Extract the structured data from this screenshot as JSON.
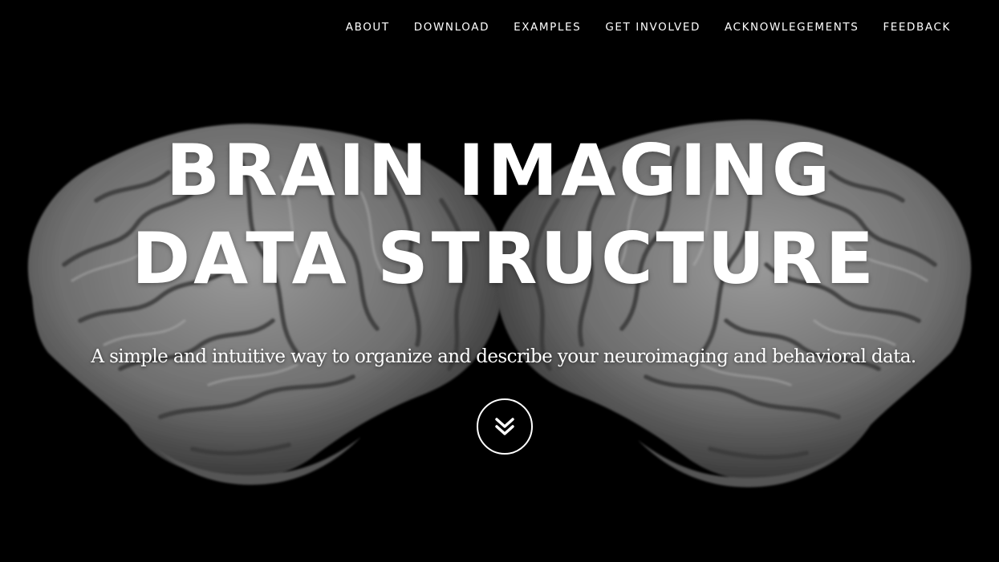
{
  "nav": {
    "items": [
      {
        "label": "ABOUT"
      },
      {
        "label": "DOWNLOAD"
      },
      {
        "label": "EXAMPLES"
      },
      {
        "label": "GET INVOLVED"
      },
      {
        "label": "ACKNOWLEGEMENTS"
      },
      {
        "label": "FEEDBACK"
      }
    ]
  },
  "hero": {
    "title_line1": "BRAIN IMAGING",
    "title_line2": "DATA STRUCTURE",
    "subtitle": "A simple and intuitive way to organize and describe your neuroimaging and behavioral data.",
    "scroll_icon": "double-chevron-down-icon"
  },
  "colors": {
    "background": "#000000",
    "text": "#ffffff",
    "brain_surface": "#8a8a8a"
  }
}
